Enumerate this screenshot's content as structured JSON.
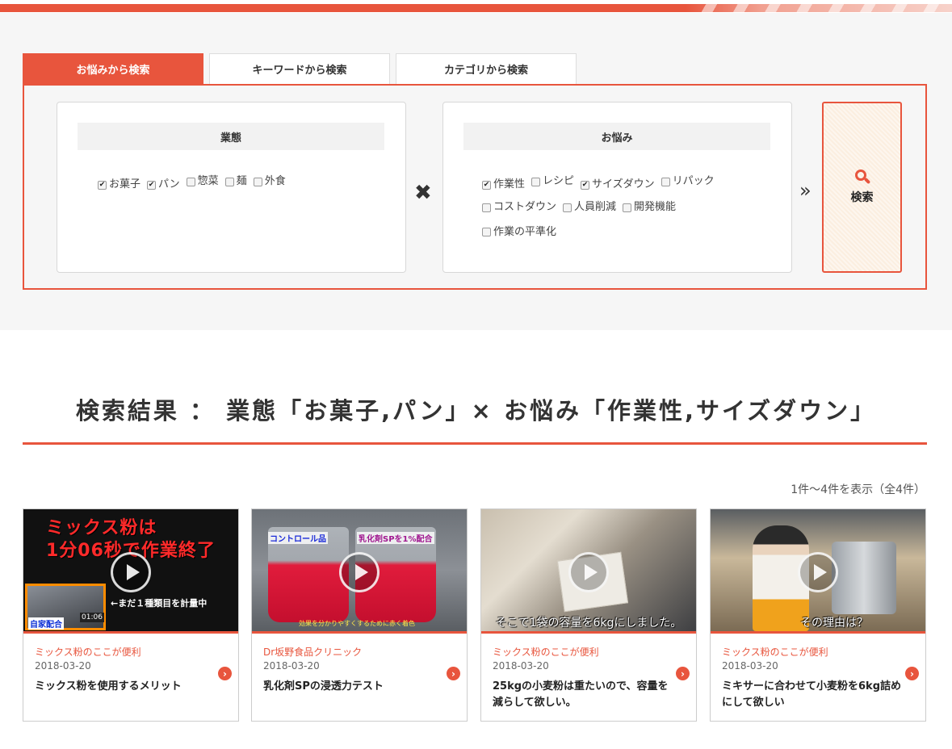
{
  "colors": {
    "accent": "#e8553d",
    "panel_bg": "#f6f6f6"
  },
  "tabs": [
    {
      "label": "お悩みから検索",
      "active": true
    },
    {
      "label": "キーワードから検索",
      "active": false
    },
    {
      "label": "カテゴリから検索",
      "active": false
    }
  ],
  "industry": {
    "heading": "業態",
    "options": [
      {
        "label": "お菓子",
        "checked": true
      },
      {
        "label": "パン",
        "checked": true
      },
      {
        "label": "惣菜",
        "checked": false
      },
      {
        "label": "麺",
        "checked": false
      },
      {
        "label": "外食",
        "checked": false
      }
    ]
  },
  "concern": {
    "heading": "お悩み",
    "options": [
      {
        "label": "作業性",
        "checked": true
      },
      {
        "label": "レシピ",
        "checked": false
      },
      {
        "label": "サイズダウン",
        "checked": true
      },
      {
        "label": "リパック",
        "checked": false
      },
      {
        "label": "コストダウン",
        "checked": false
      },
      {
        "label": "人員削減",
        "checked": false
      },
      {
        "label": "開発機能",
        "checked": false
      },
      {
        "label": "作業の平準化",
        "checked": false
      }
    ]
  },
  "icons": {
    "times": "✖",
    "chevron": "»",
    "search": "search-icon",
    "check": "✔",
    "arrow": "›"
  },
  "search_button": {
    "label": "検索"
  },
  "results": {
    "title": "検索結果 ： 業態「お菓子,パン」× お悩み「作業性,サイズダウン」",
    "count": "1件～4件を表示（全4件）",
    "cards": [
      {
        "category": "ミックス粉のここが便利",
        "date": "2018-03-20",
        "title": "ミックス粉を使用するメリット",
        "thumb": {
          "text1": "ミックス粉は",
          "text2": "1分06秒で作業終了",
          "inset_label": "自家配合",
          "timer": "01:06",
          "note": "←まだ１種類目を計量中"
        }
      },
      {
        "category": "Dr坂野食品クリニック",
        "date": "2018-03-20",
        "title": "乳化剤SPの浸透力テスト",
        "thumb": {
          "label_a": "コントロール品",
          "label_b": "乳化剤SPを1%配合",
          "caption": "効果を分かりやすくするために赤く着色"
        }
      },
      {
        "category": "ミックス粉のここが便利",
        "date": "2018-03-20",
        "title": "25kgの小麦粉は重たいので、容量を減らして欲しい。",
        "thumb": {
          "caption": "そこで1袋の容量を6kgにしました。"
        }
      },
      {
        "category": "ミックス粉のここが便利",
        "date": "2018-03-20",
        "title": "ミキサーに合わせて小麦粉を6kg詰めにして欲しい",
        "thumb": {
          "caption": "その理由は？"
        }
      }
    ]
  }
}
